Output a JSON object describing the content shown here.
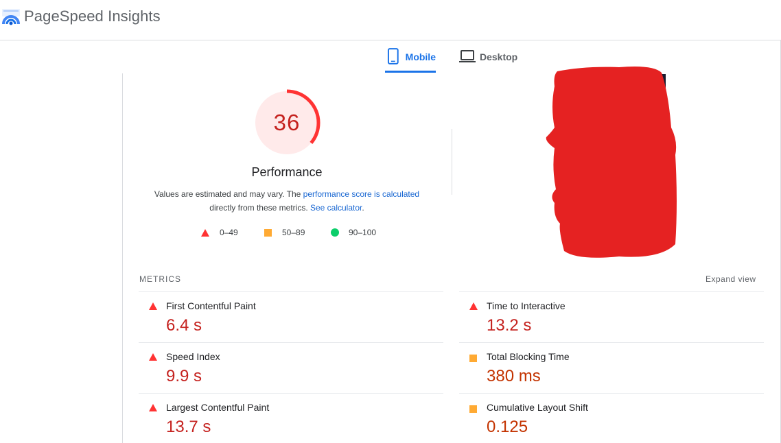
{
  "header": {
    "title": "PageSpeed Insights"
  },
  "tabs": [
    {
      "label": "Mobile",
      "active": true
    },
    {
      "label": "Desktop",
      "active": false
    }
  ],
  "performance": {
    "score": "36",
    "score_value": 36,
    "title": "Performance",
    "desc_text1": "Values are estimated and may vary. The ",
    "desc_link1": "performance score is calculated",
    "desc_text2": "directly from these metrics. ",
    "desc_link2": "See calculator",
    "desc_text3": "."
  },
  "legend": {
    "poor": "0–49",
    "average": "50–89",
    "good": "90–100"
  },
  "metrics": {
    "label": "METRICS",
    "expand_label": "Expand view",
    "items": [
      {
        "name": "First Contentful Paint",
        "value": "6.4 s",
        "rating": "poor"
      },
      {
        "name": "Time to Interactive",
        "value": "13.2 s",
        "rating": "poor"
      },
      {
        "name": "Speed Index",
        "value": "9.9 s",
        "rating": "poor"
      },
      {
        "name": "Total Blocking Time",
        "value": "380 ms",
        "rating": "average"
      },
      {
        "name": "Largest Contentful Paint",
        "value": "13.7 s",
        "rating": "poor"
      },
      {
        "name": "Cumulative Layout Shift",
        "value": "0.125",
        "rating": "average"
      }
    ]
  },
  "colors": {
    "poor": "#ff3333",
    "average": "#ffaa33",
    "good": "#0cce6b",
    "accent": "#1a73e8",
    "redaction": "#e52222"
  }
}
